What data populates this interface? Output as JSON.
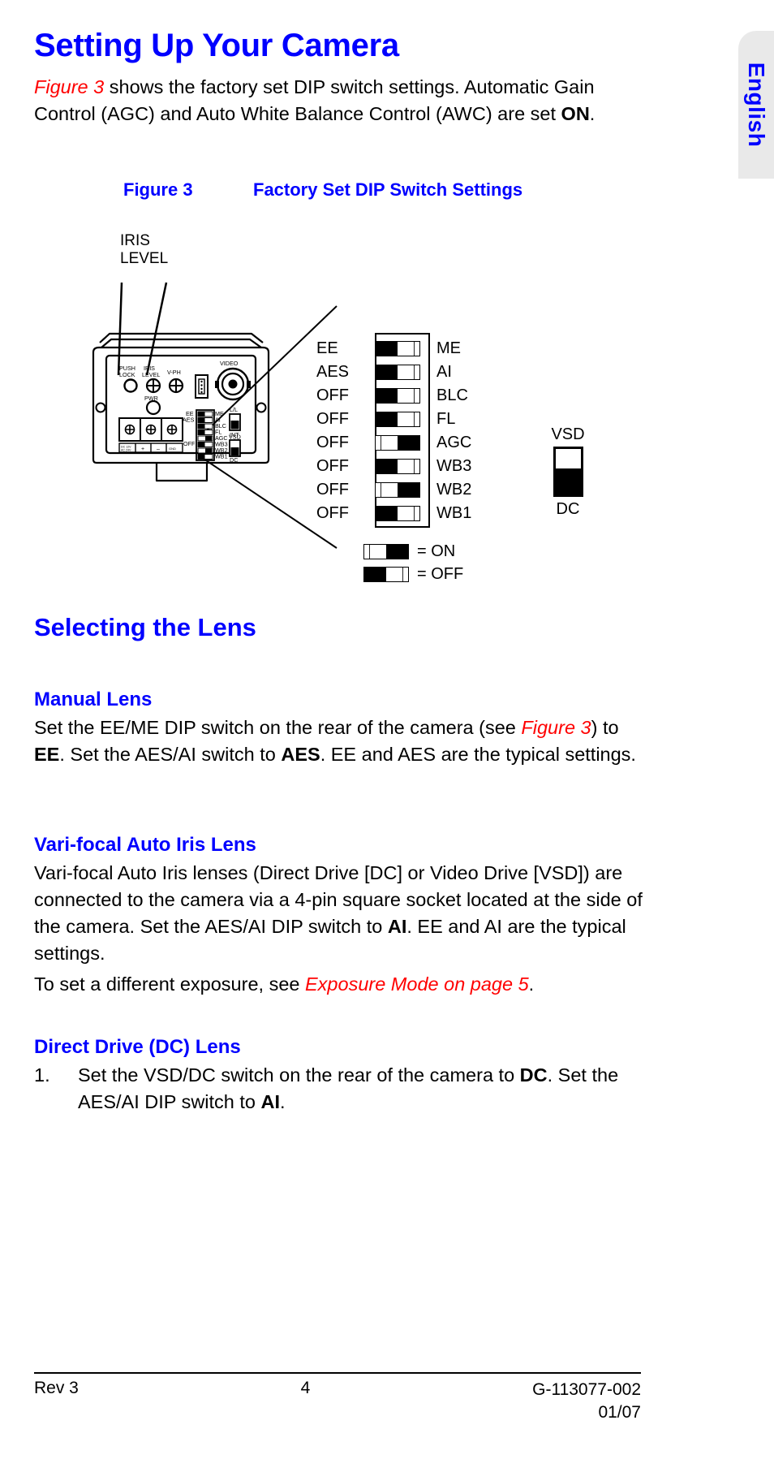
{
  "language_tab": {
    "label": "English"
  },
  "heading": {
    "title": "Setting Up Your Camera"
  },
  "intro": {
    "figure_ref": "Figure 3",
    "text_1": " shows the factory set DIP switch settings. Automatic Gain Control (AGC) and Auto White Balance Control (AWC) are set ",
    "bold_on": "ON",
    "text_2": "."
  },
  "figure": {
    "caption_number": "Figure 3",
    "caption_title": "Factory Set DIP Switch Settings",
    "iris_label_line1": "IRIS",
    "iris_label_line2": "LEVEL",
    "camera_labels": {
      "push_lock_l1": "PUSH",
      "push_lock_l2": "LOCK",
      "iris_level_l1": "IRIS",
      "iris_level_l2": "LEVEL",
      "v_ph": "V-PH",
      "pwr": "PWR",
      "video": "VIDEO",
      "ll": "L/L",
      "int": "INT",
      "vsd": "VSD",
      "dc": "DC",
      "ee": "EE",
      "aes": "AES",
      "off": "OFF",
      "sw_names": [
        "ME",
        "AI",
        "BLC",
        "FL",
        "AGC",
        "WB3",
        "WB2",
        "WB1"
      ],
      "term_dcin": "DC 12V",
      "term_acin": "AC 24V",
      "term_plus": "+",
      "term_minus": "–",
      "term_gnd": "GND"
    },
    "dip_rows": [
      {
        "left": "EE",
        "right": "ME",
        "state": "off"
      },
      {
        "left": "AES",
        "right": "AI",
        "state": "off"
      },
      {
        "left": "OFF",
        "right": "BLC",
        "state": "off"
      },
      {
        "left": "OFF",
        "right": "FL",
        "state": "off"
      },
      {
        "left": "OFF",
        "right": "AGC",
        "state": "on"
      },
      {
        "left": "OFF",
        "right": "WB3",
        "state": "off"
      },
      {
        "left": "OFF",
        "right": "WB2",
        "state": "on"
      },
      {
        "left": "OFF",
        "right": "WB1",
        "state": "off"
      }
    ],
    "vsd_toggle": {
      "top_label": "VSD",
      "bottom_label": "DC",
      "position": "DC"
    },
    "legend": [
      {
        "state": "on",
        "text": "= ON"
      },
      {
        "state": "off",
        "text": "= OFF"
      }
    ]
  },
  "sections": {
    "selecting_lens": {
      "title": "Selecting the Lens"
    },
    "manual_lens": {
      "title": "Manual Lens",
      "p1_a": "Set the EE/ME DIP switch on the rear of the camera (see ",
      "p1_ref": "Figure 3",
      "p1_b": ") to ",
      "p1_bold1": "EE",
      "p1_c": ". Set the AES/AI switch to ",
      "p1_bold2": "AES",
      "p1_d": ". EE and AES are the typical settings."
    },
    "vari_focal": {
      "title": "Vari-focal Auto Iris Lens",
      "p1_a": "Vari-focal Auto Iris lenses (Direct Drive [DC] or Video Drive [VSD]) are connected to the camera via a 4-pin square socket located at the side of the camera. Set the AES/AI DIP switch to ",
      "p1_bold": "AI",
      "p1_b": ". EE and AI are the typical settings."
    },
    "exposure_note": {
      "a": "To set a different exposure, see ",
      "ref": "Exposure Mode on page 5",
      "b": "."
    },
    "direct_drive": {
      "title": "Direct Drive (DC) Lens",
      "item_num": "1.",
      "item_a": "Set the VSD/DC switch on the rear of the camera to ",
      "item_bold1": "DC",
      "item_b": ". Set the AES/AI DIP switch to ",
      "item_bold2": "AI",
      "item_c": "."
    }
  },
  "footer": {
    "left": "Rev  3",
    "center": "4",
    "right_line1": "G-113077-002",
    "right_line2": "01/07"
  },
  "colors": {
    "heading_blue": "#0000ff",
    "ref_red": "#ff0000",
    "tab_bg": "#e9e9e9"
  }
}
